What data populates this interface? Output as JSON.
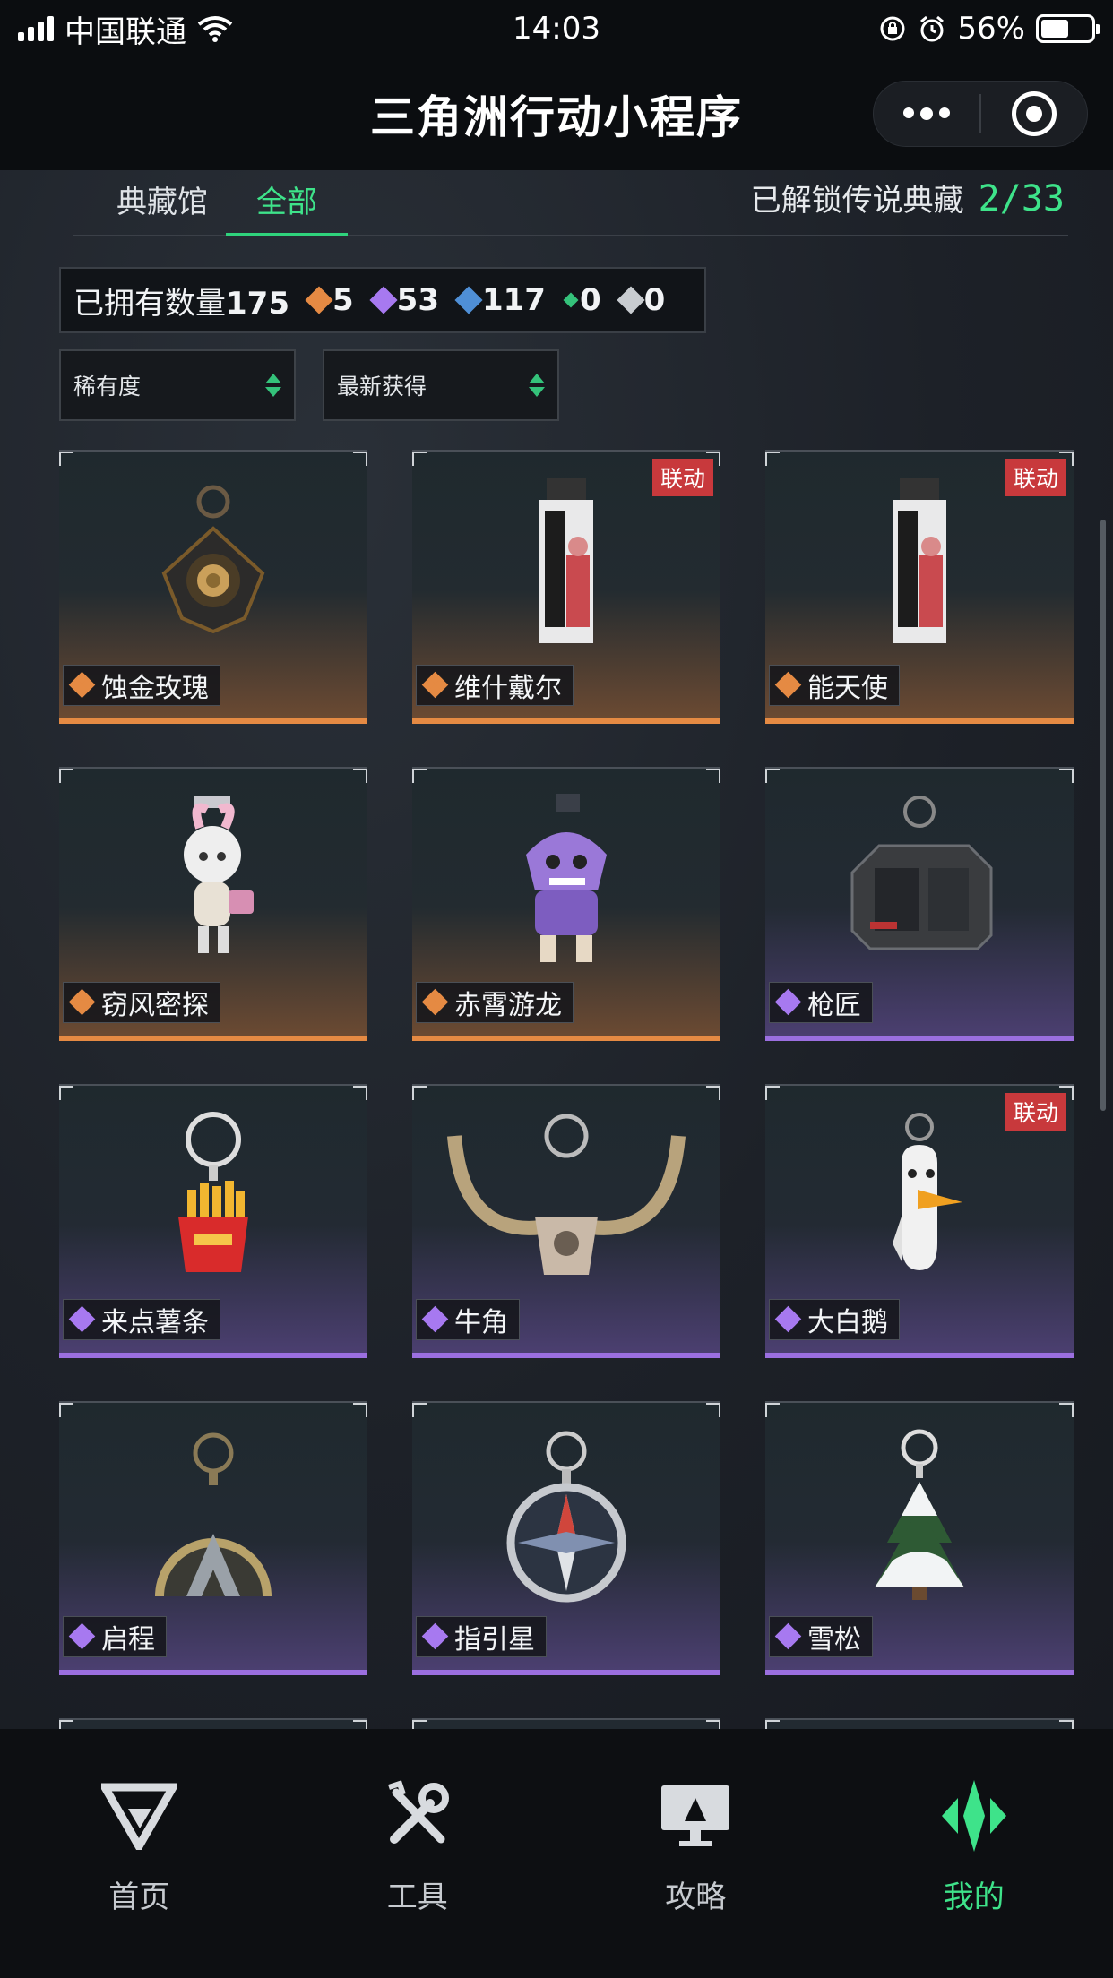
{
  "status_bar": {
    "carrier": "中国联通",
    "time": "14:03",
    "battery": "56%",
    "battery_level": 0.56
  },
  "title_bar": {
    "title": "三角洲行动小程序"
  },
  "tabs": {
    "items": [
      "典藏馆",
      "全部"
    ],
    "active": "全部"
  },
  "unlock": {
    "label": "已解锁传说典藏",
    "count": "2/33"
  },
  "owned": {
    "label": "已拥有数量",
    "total": "175",
    "counts": [
      {
        "value": "5",
        "color": "#e58a43"
      },
      {
        "value": "53",
        "color": "#a779f0"
      },
      {
        "value": "117",
        "color": "#4f8fd6"
      },
      {
        "value": "0",
        "color": "#34c27a"
      },
      {
        "value": "0",
        "color": "#c8ccd0"
      }
    ]
  },
  "filters": {
    "rarity": "稀有度",
    "sort": "最新获得"
  },
  "collab_badge": "联动",
  "items": [
    {
      "name": "蚀金玫瑰",
      "rarity": "legend",
      "collab": false,
      "icon": "golden-rose-keychain-icon"
    },
    {
      "name": "维什戴尔",
      "rarity": "legend",
      "collab": true,
      "icon": "card-keychain-icon"
    },
    {
      "name": "能天使",
      "rarity": "legend",
      "collab": true,
      "icon": "card-keychain-icon"
    },
    {
      "name": "窃风密探",
      "rarity": "legend",
      "collab": false,
      "icon": "bunny-figure-icon"
    },
    {
      "name": "赤霄游龙",
      "rarity": "legend",
      "collab": false,
      "icon": "dragon-figure-icon"
    },
    {
      "name": "枪匠",
      "rarity": "epic",
      "collab": false,
      "icon": "gun-case-icon"
    },
    {
      "name": "来点薯条",
      "rarity": "epic",
      "collab": false,
      "icon": "fries-icon"
    },
    {
      "name": "牛角",
      "rarity": "epic",
      "collab": false,
      "icon": "horns-icon"
    },
    {
      "name": "大白鹅",
      "rarity": "epic",
      "collab": true,
      "icon": "goose-icon"
    },
    {
      "name": "启程",
      "rarity": "epic",
      "collab": false,
      "icon": "medal-icon"
    },
    {
      "name": "指引星",
      "rarity": "epic",
      "collab": false,
      "icon": "compass-icon"
    },
    {
      "name": "雪松",
      "rarity": "epic",
      "collab": false,
      "icon": "pine-tree-icon"
    }
  ],
  "nav": [
    {
      "label": "首页",
      "icon": "home-logo-icon",
      "active": false
    },
    {
      "label": "工具",
      "icon": "tools-icon",
      "active": false
    },
    {
      "label": "攻略",
      "icon": "guide-monitor-icon",
      "active": false
    },
    {
      "label": "我的",
      "icon": "profile-logo-icon",
      "active": true
    }
  ]
}
